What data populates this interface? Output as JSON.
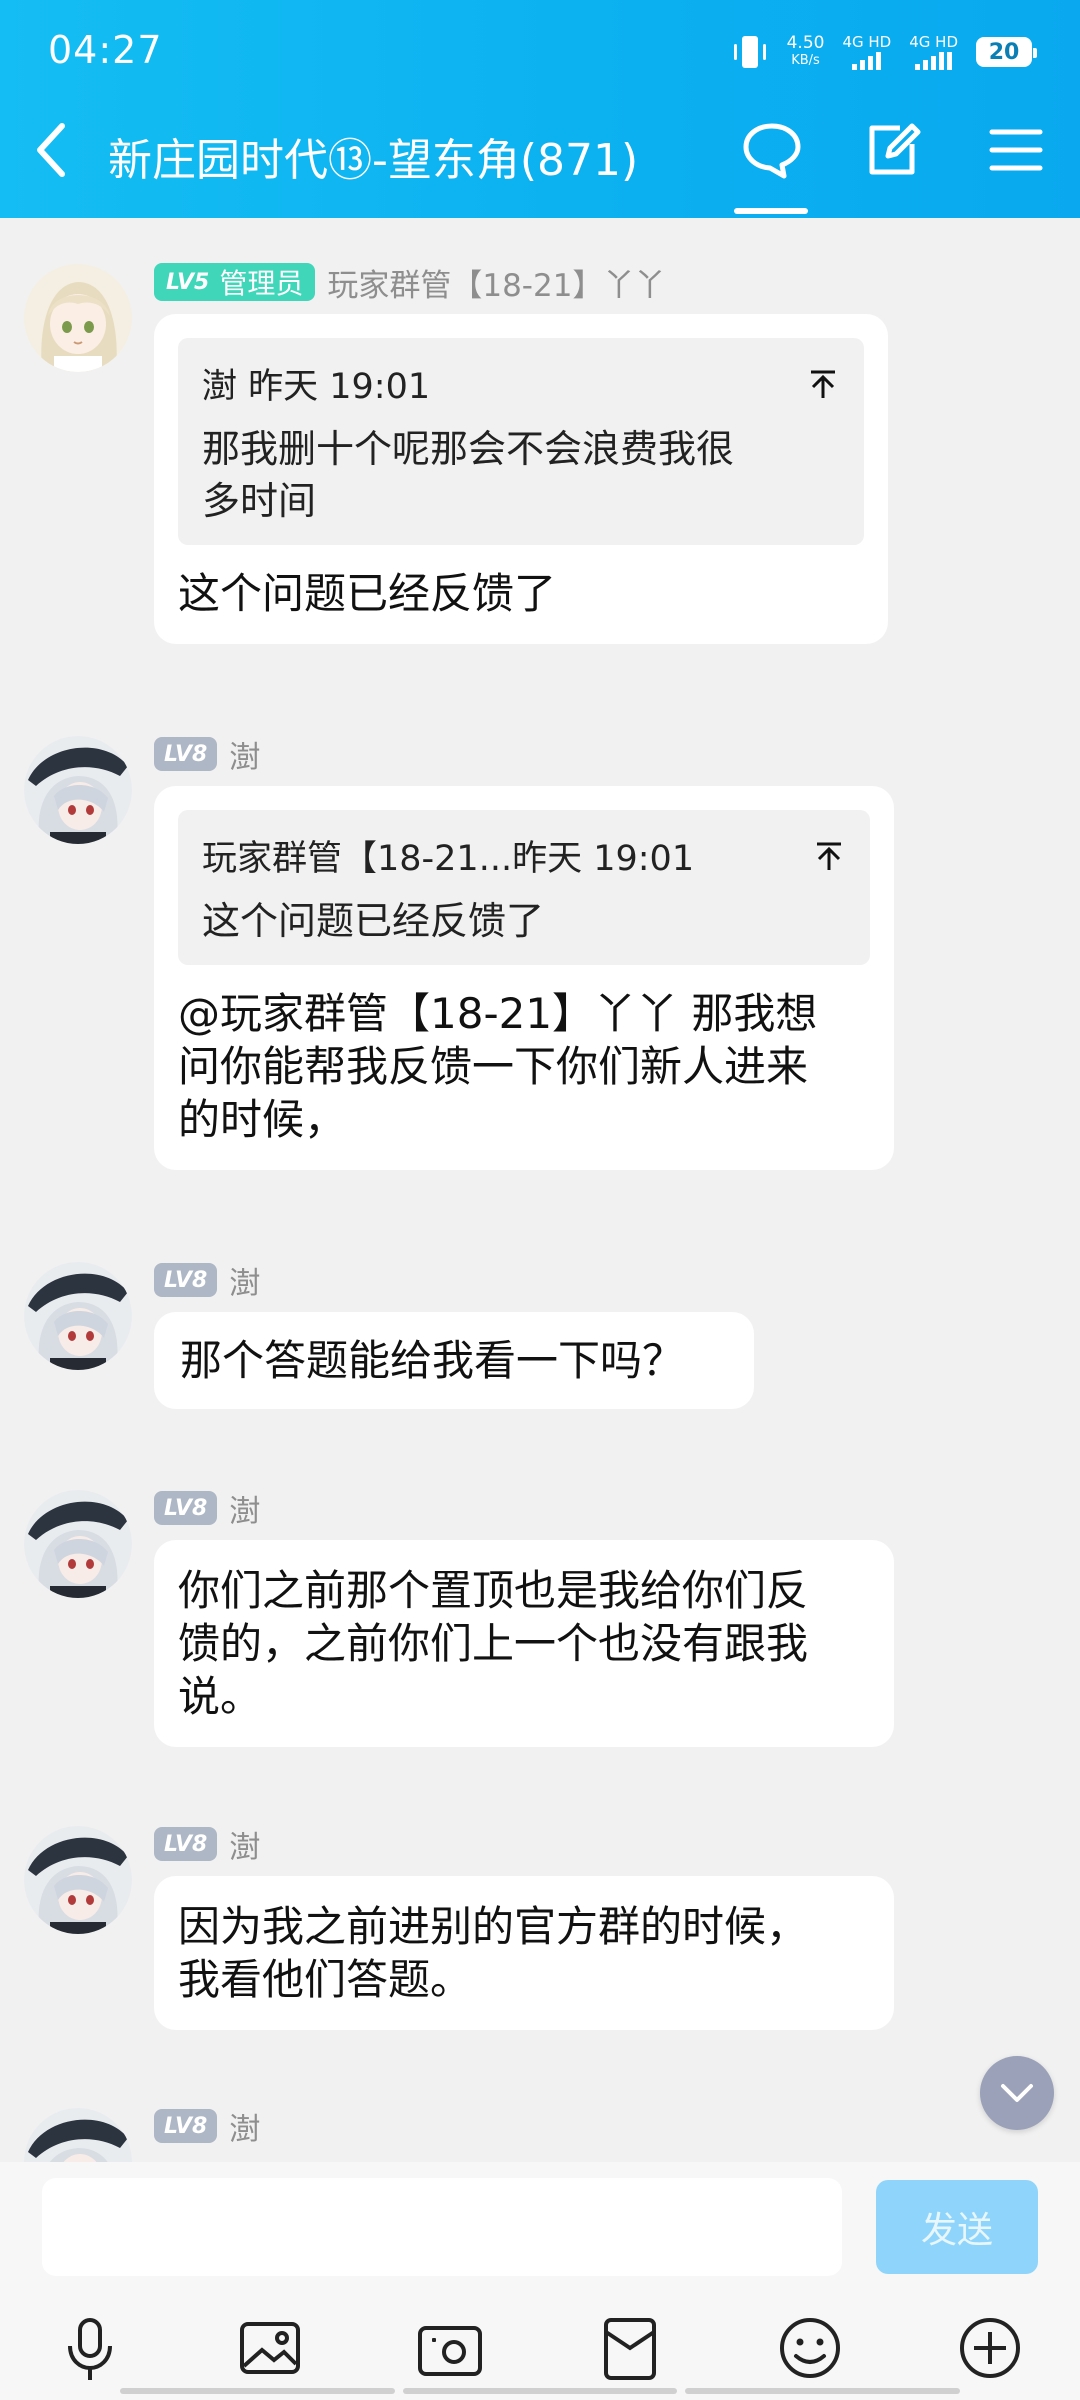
{
  "status_bar": {
    "time": "04:27",
    "net_speed_value": "4.50",
    "net_speed_unit": "KB/s",
    "sim1": "4G HD",
    "sim2": "4G HD",
    "battery": "20"
  },
  "header": {
    "title": "新庄园时代⑬-望东角(871)"
  },
  "colors": {
    "header_bg": "#0bb0f0",
    "admin_badge": "#3fd6b9",
    "level_badge": "#aeb7c6",
    "send_button": "#8fd5fb"
  },
  "messages": [
    {
      "badge_level": "LV5",
      "badge_role": "管理员",
      "sender": "玩家群管【18-21】丫丫",
      "avatar": "blonde-anime-avatar",
      "quote": {
        "author": "澍",
        "time": "昨天 19:01",
        "text": "那我删十个呢那会不会浪费我很\n多时间"
      },
      "text": "这个问题已经反馈了"
    },
    {
      "badge_level": "LV8",
      "sender": "澍",
      "avatar": "silver-hair-anime-avatar",
      "quote": {
        "author": "玩家群管【18-21...",
        "time": "昨天 19:01",
        "text": "这个问题已经反馈了"
      },
      "text": "@玩家群管【18-21】丫丫 那我想\n问你能帮我反馈一下你们新人进来\n的时候，"
    },
    {
      "badge_level": "LV8",
      "sender": "澍",
      "avatar": "silver-hair-anime-avatar",
      "text": "那个答题能给我看一下吗？"
    },
    {
      "badge_level": "LV8",
      "sender": "澍",
      "avatar": "silver-hair-anime-avatar",
      "text": "你们之前那个置顶也是我给你们反\n馈的，之前你们上一个也没有跟我\n说。"
    },
    {
      "badge_level": "LV8",
      "sender": "澍",
      "avatar": "silver-hair-anime-avatar",
      "text": "因为我之前进别的官方群的时候，\n我看他们答题。"
    },
    {
      "badge_level": "LV8",
      "sender": "澍",
      "avatar": "silver-hair-anime-avatar"
    }
  ],
  "input": {
    "placeholder": "",
    "send_label": "发送"
  },
  "toolbar": [
    "microphone-icon",
    "image-icon",
    "camera-icon",
    "red-packet-icon",
    "emoji-icon",
    "plus-icon"
  ]
}
